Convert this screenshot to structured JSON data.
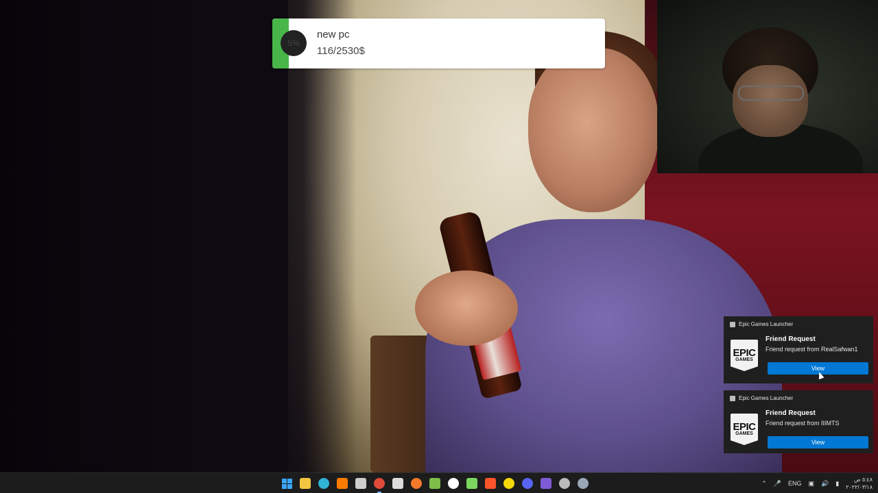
{
  "goal": {
    "name": "new pc",
    "amount": "116/2530$",
    "percent_label": "5%",
    "progress_fraction": 0.05,
    "bar_color": "#48b649"
  },
  "notifications": [
    {
      "app": "Epic Games Launcher",
      "logo_line1": "EPIC",
      "logo_line2": "GAMES",
      "title": "Friend Request",
      "message": "Friend request from RealSafwan1",
      "button": "View"
    },
    {
      "app": "Epic Games Launcher",
      "logo_line1": "EPIC",
      "logo_line2": "GAMES",
      "title": "Friend Request",
      "message": "Friend request from IIIMTS",
      "button": "View"
    }
  ],
  "taskbar": {
    "apps": [
      {
        "name": "start-icon",
        "color": "#3ba6ff"
      },
      {
        "name": "file-explorer-icon",
        "color": "#f4c542"
      },
      {
        "name": "edge-icon",
        "color": "#2fb3d6"
      },
      {
        "name": "illustrator-icon",
        "color": "#ff7c00"
      },
      {
        "name": "microsoft-store-icon",
        "color": "#cfcfcf"
      },
      {
        "name": "chrome-icon",
        "color": "#e04a3a"
      },
      {
        "name": "seven-zip-icon",
        "color": "#dddddd"
      },
      {
        "name": "blender-icon",
        "color": "#f5792a"
      },
      {
        "name": "layers-app-icon",
        "color": "#7dbf4a"
      },
      {
        "name": "chat-app-icon",
        "color": "#ffffff"
      },
      {
        "name": "terminal-icon",
        "color": "#7cd75f"
      },
      {
        "name": "brave-icon",
        "color": "#fb542b"
      },
      {
        "name": "media-player-icon",
        "color": "#f5d90a"
      },
      {
        "name": "discord-icon",
        "color": "#5865f2"
      },
      {
        "name": "affinity-icon",
        "color": "#7f5bd5"
      },
      {
        "name": "obs-icon",
        "color": "#bbbbbb"
      },
      {
        "name": "settings-icon",
        "color": "#9aa7b8"
      }
    ],
    "language": "ENG",
    "time": "٥:٤٨ ص",
    "date": "٢٠٢٢/٠٣/١٨"
  }
}
